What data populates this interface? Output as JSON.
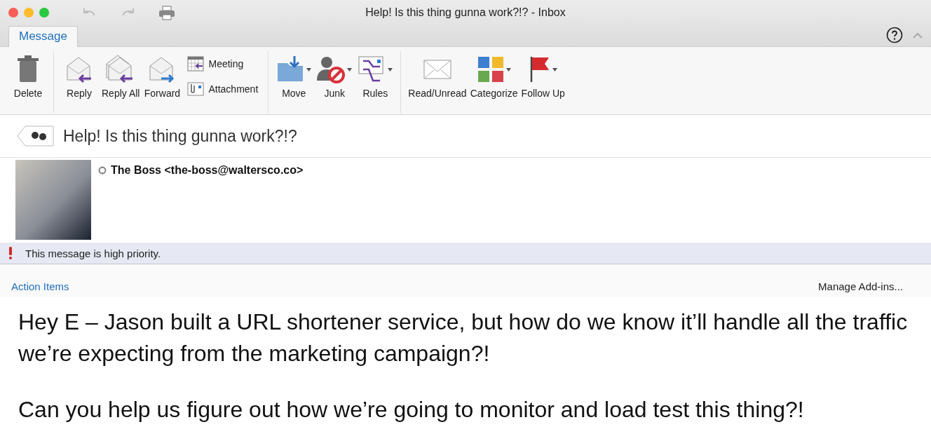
{
  "window": {
    "title": "Help! Is this thing gunna work?!? - Inbox"
  },
  "tabs": [
    {
      "label": "Message",
      "selected": true
    }
  ],
  "ribbon": {
    "groups": [
      {
        "buttons": [
          {
            "label": "Delete",
            "dropdown": false
          }
        ]
      },
      {
        "buttons": [
          {
            "label": "Reply",
            "dropdown": false
          },
          {
            "label": "Reply All",
            "dropdown": false
          },
          {
            "label": "Forward",
            "dropdown": false
          }
        ],
        "small_buttons": [
          "Meeting",
          "Attachment"
        ]
      },
      {
        "buttons": [
          {
            "label": "Move",
            "dropdown": true
          },
          {
            "label": "Junk",
            "dropdown": true
          },
          {
            "label": "Rules",
            "dropdown": true
          }
        ]
      },
      {
        "buttons": [
          {
            "label": "Read/Unread",
            "dropdown": false
          },
          {
            "label": "Categorize",
            "dropdown": true
          },
          {
            "label": "Follow Up",
            "dropdown": true
          }
        ]
      }
    ]
  },
  "message": {
    "subject": "Help! Is this thing gunna work?!?",
    "sender": "The Boss <the-boss@waltersco.co>",
    "priority_notice": "This message is high priority.",
    "action_items": "Action Items",
    "manage_addins": "Manage Add-ins...",
    "body": [
      "Hey E – Jason built a URL shortener service, but how do we know it’ll handle all the traffic we’re expecting from the marketing campaign?!",
      "Can you help us figure out how we’re going to monitor and load test this thing?!"
    ]
  }
}
